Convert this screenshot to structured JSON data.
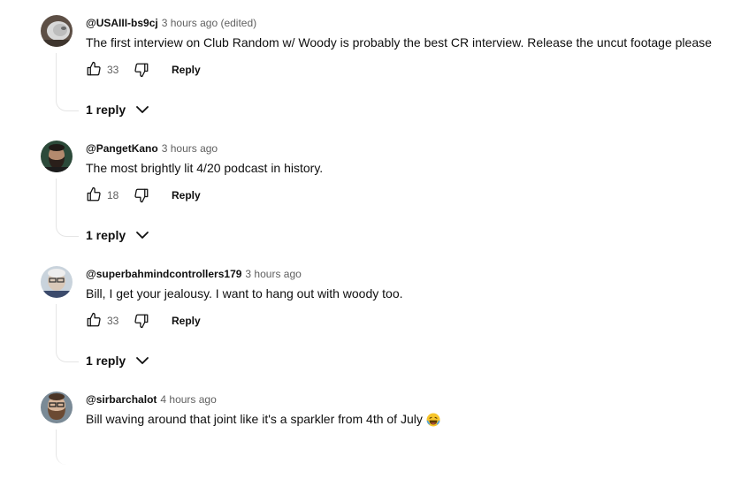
{
  "comments": [
    {
      "author": "@USAIII-bs9cj",
      "time": "3 hours ago (edited)",
      "text": "The first interview on Club Random w/ Woody is probably the best CR interview.  Release the uncut footage please",
      "likes": "33",
      "reply_label": "Reply",
      "replies_label": "1 reply",
      "avatar_icon": "avatar-gray-cat"
    },
    {
      "author": "@PangetKano",
      "time": "3 hours ago",
      "text": "The most brightly lit 4/20 podcast in history.",
      "likes": "18",
      "reply_label": "Reply",
      "replies_label": "1 reply",
      "avatar_icon": "avatar-bearded-man"
    },
    {
      "author": "@superbahmindcontrollers179",
      "time": "3 hours ago",
      "text": "Bill, I get your jealousy.  I want to hang out with woody too.",
      "likes": "33",
      "reply_label": "Reply",
      "replies_label": "1 reply",
      "avatar_icon": "avatar-man-glasses"
    },
    {
      "author": "@sirbarchalot",
      "time": "4 hours ago",
      "text": "Bill waving around that joint like it's a sparkler from 4th of July",
      "emoji": "😂",
      "avatar_icon": "avatar-bearded-glasses"
    }
  ]
}
